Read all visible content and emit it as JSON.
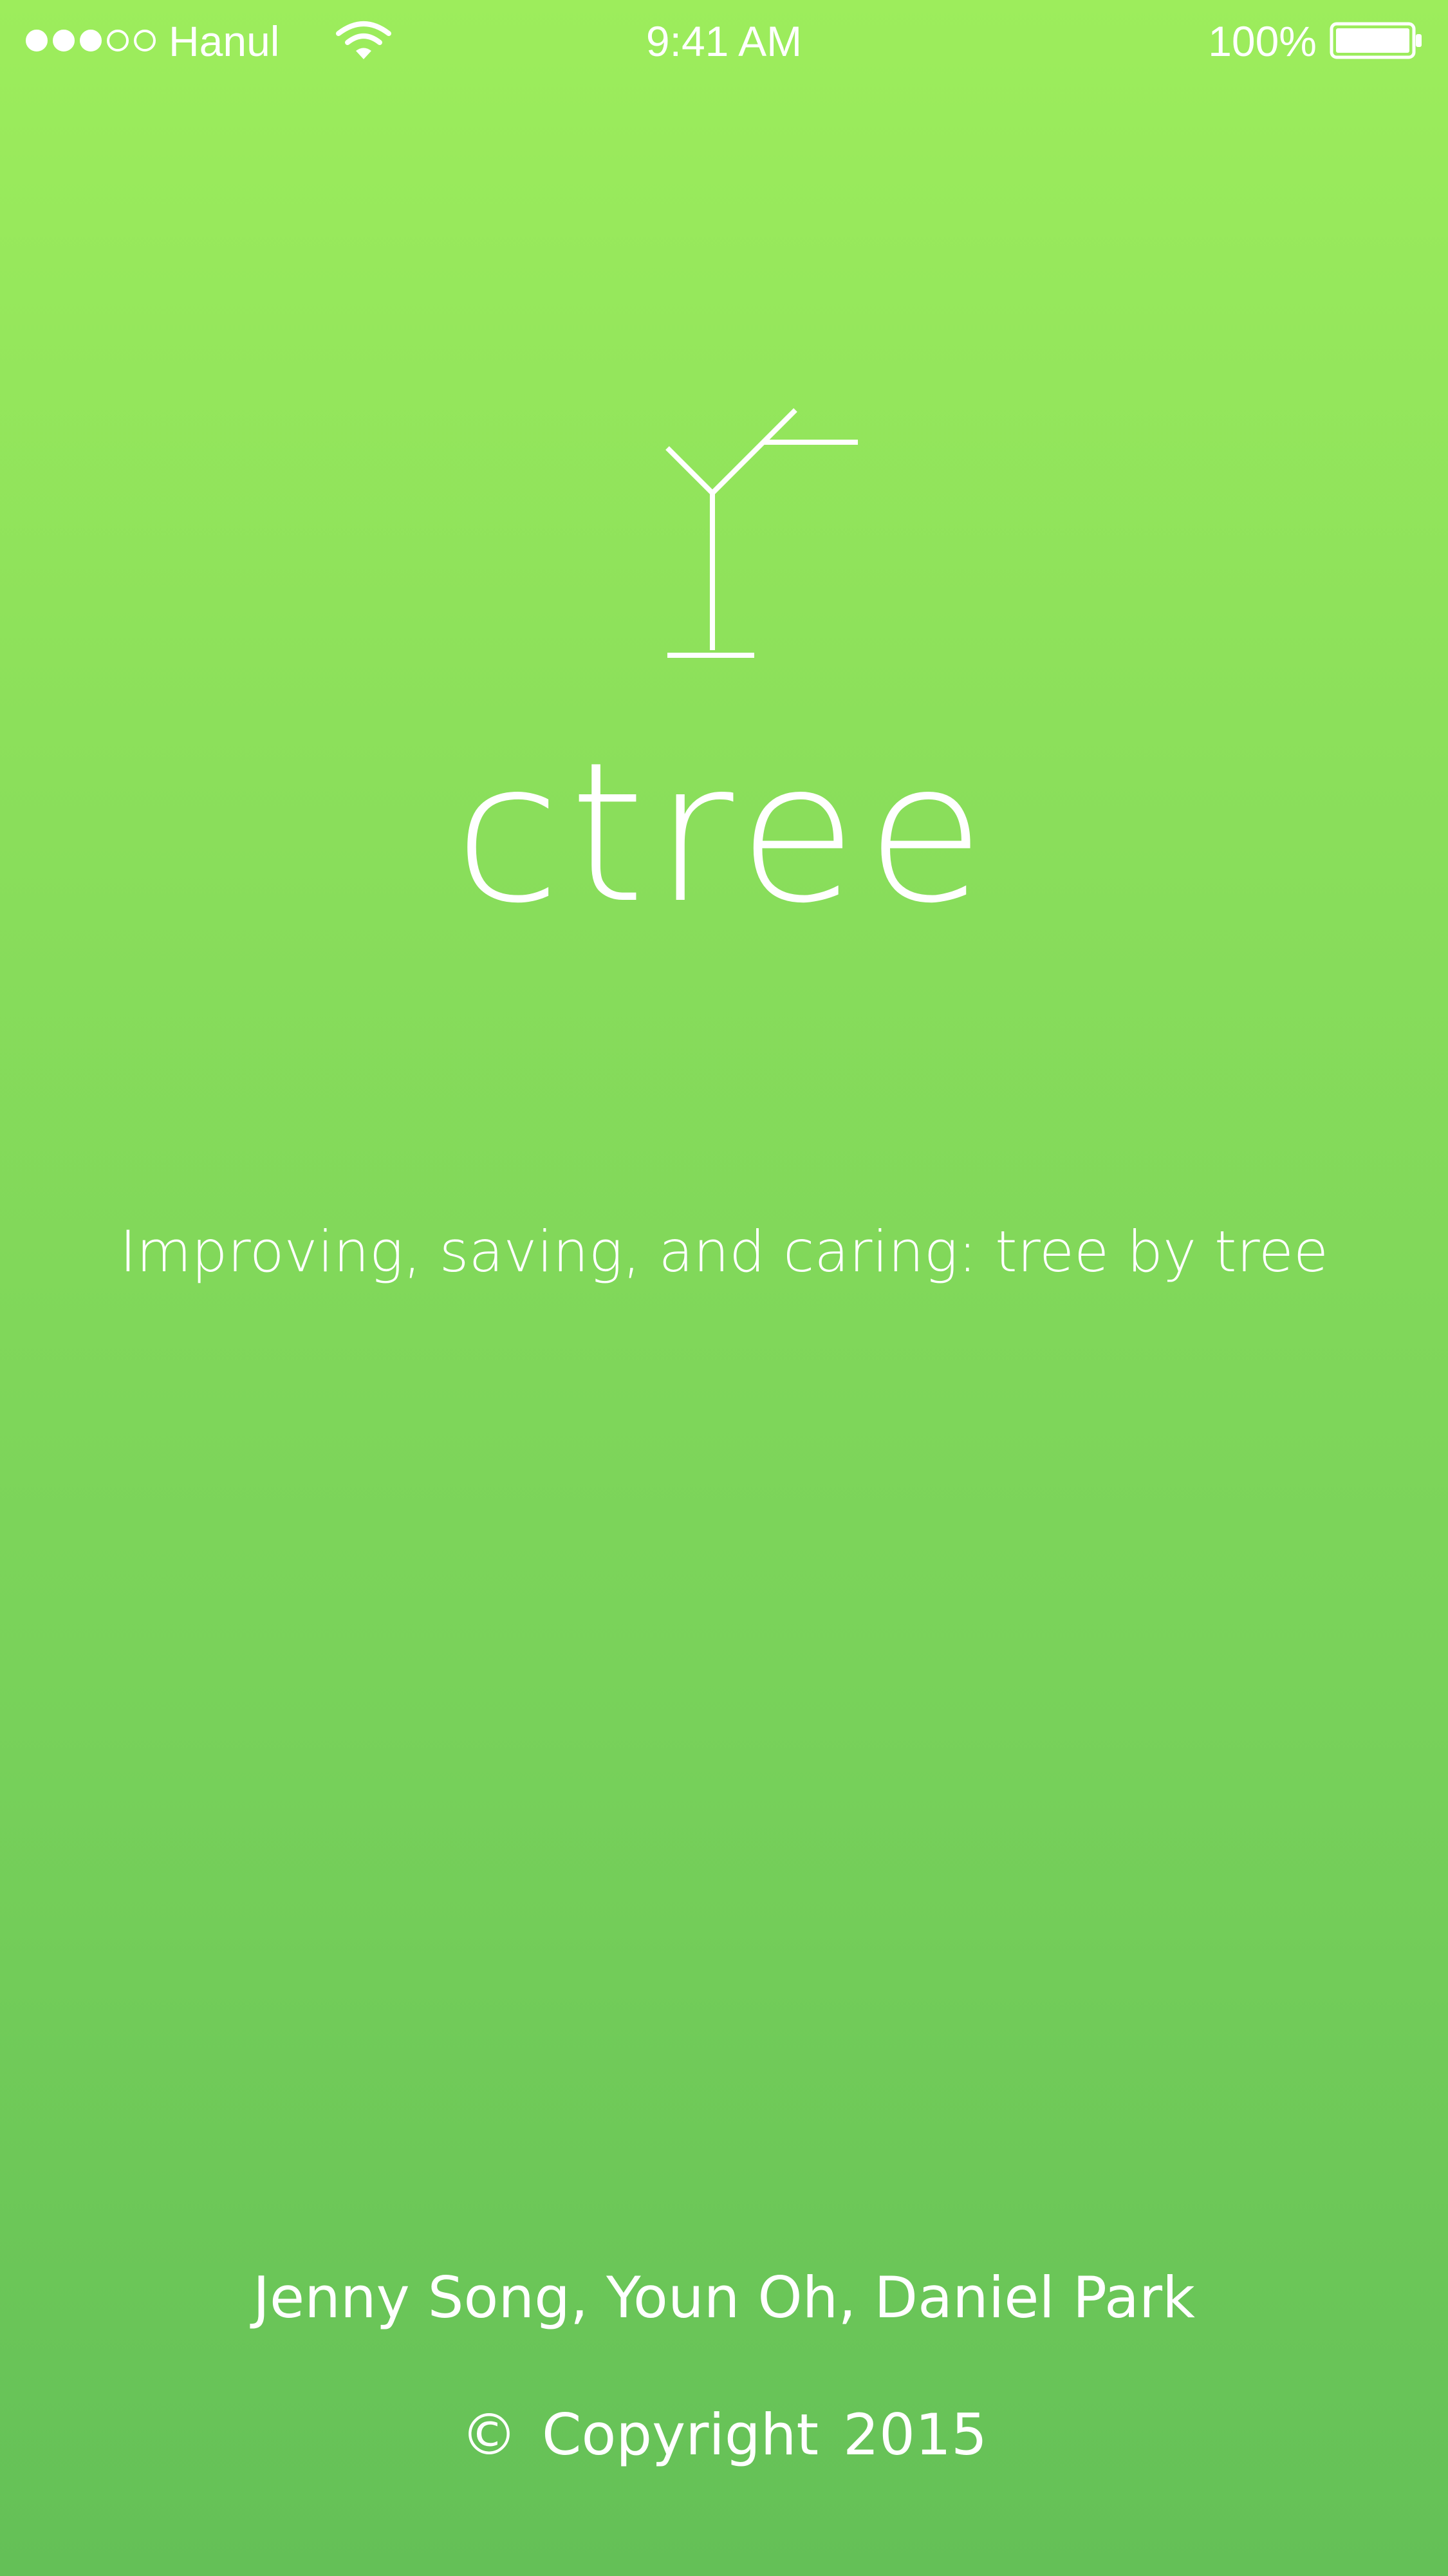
{
  "status_bar": {
    "signal_bars_filled": 3,
    "signal_bars_total": 5,
    "carrier": "Hanul",
    "wifi_icon": "wifi-icon",
    "time": "9:41 AM",
    "battery_percent": "100%",
    "battery_icon": "battery-icon",
    "battery_level": 1.0
  },
  "splash": {
    "logo_icon": "tree-logo-icon",
    "app_name": "ctree",
    "tagline": "Improving, saving, and caring: tree by tree",
    "authors": "Jenny Song, Youn Oh, Daniel Park",
    "copyright": "©  Copyright 2015"
  },
  "colors": {
    "gradient_top": "#9ded5c",
    "gradient_bottom": "#64c057",
    "foreground": "#ffffff"
  }
}
